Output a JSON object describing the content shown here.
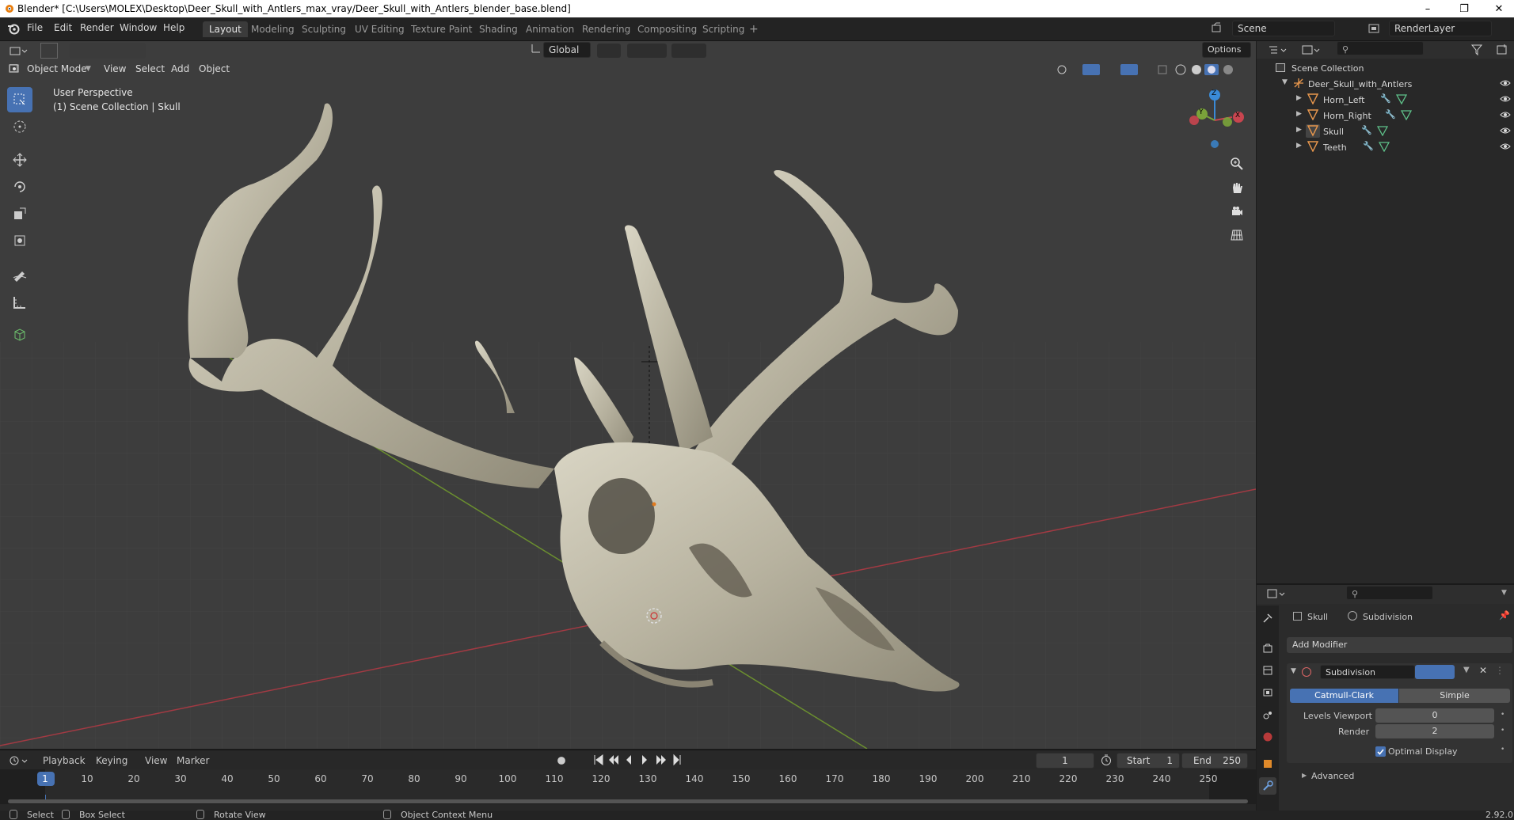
{
  "window": {
    "title": "Blender* [C:\\Users\\MOLEX\\Desktop\\Deer_Skull_with_Antlers_max_vray/Deer_Skull_with_Antlers_blender_base.blend]"
  },
  "menus": [
    "File",
    "Edit",
    "Render",
    "Window",
    "Help"
  ],
  "workspaces": [
    "Layout",
    "Modeling",
    "Sculpting",
    "UV Editing",
    "Texture Paint",
    "Shading",
    "Animation",
    "Rendering",
    "Compositing",
    "Scripting"
  ],
  "header": {
    "scene": "Scene",
    "render_layer": "RenderLayer"
  },
  "toolbar": {
    "orientation": "Global",
    "options": "Options"
  },
  "viewport": {
    "mode": "Object Mode",
    "menu": [
      "View",
      "Select",
      "Add",
      "Object"
    ],
    "info_line1": "User Perspective",
    "info_line2": "(1) Scene Collection | Skull",
    "gizmo": {
      "z": "Z",
      "y": "Y",
      "x": "X"
    }
  },
  "outliner": {
    "root": "Scene Collection",
    "collection": "Deer_Skull_with_Antlers",
    "objects": [
      "Horn_Left",
      "Horn_Right",
      "Skull",
      "Teeth"
    ]
  },
  "properties": {
    "object": "Skull",
    "modifier_context": "Subdivision",
    "add_modifier": "Add Modifier",
    "modifier_name": "Subdivision",
    "algo_catmull": "Catmull-Clark",
    "algo_simple": "Simple",
    "levels_viewport_label": "Levels Viewport",
    "levels_viewport_value": "0",
    "render_label": "Render",
    "render_value": "2",
    "optimal_display": "Optimal Display",
    "advanced": "Advanced"
  },
  "timeline": {
    "menu": [
      "Playback",
      "Keying",
      "View",
      "Marker"
    ],
    "current_frame": "1",
    "start_label": "Start",
    "start": "1",
    "end_label": "End",
    "end": "250",
    "ticks": [
      "1",
      "10",
      "20",
      "30",
      "40",
      "50",
      "60",
      "70",
      "80",
      "90",
      "100",
      "110",
      "120",
      "130",
      "140",
      "150",
      "160",
      "170",
      "180",
      "190",
      "200",
      "210",
      "220",
      "230",
      "240",
      "250"
    ]
  },
  "status": {
    "select": "Select",
    "box_select": "Box Select",
    "rotate_view": "Rotate View",
    "context_menu": "Object Context Menu",
    "version": "2.92.0"
  },
  "colors": {
    "accent": "#4772b3",
    "viewport_bg": "#3d3d3d",
    "x_axis": "#c8454f",
    "y_axis": "#7aa33a",
    "z_axis": "#3a8ad6"
  }
}
